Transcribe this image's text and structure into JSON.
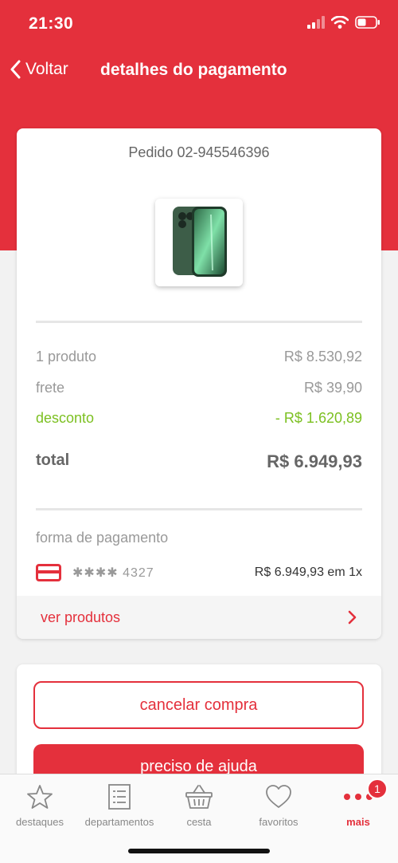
{
  "status_bar": {
    "time": "21:30"
  },
  "nav": {
    "back_label": "Voltar",
    "title": "detalhes do pagamento"
  },
  "order": {
    "number": "Pedido 02-945546396",
    "product_image": "phone-product-image",
    "summary": {
      "products_label": "1 produto",
      "products_value": "R$ 8.530,92",
      "shipping_label": "frete",
      "shipping_value": "R$ 39,90",
      "discount_label": "desconto",
      "discount_value": "- R$ 1.620,89",
      "total_label": "total",
      "total_value": "R$ 6.949,93"
    },
    "payment": {
      "label": "forma de pagamento",
      "card_masked": "✱✱✱✱ 4327",
      "amount": "R$ 6.949,93 em 1x"
    },
    "see_products_label": "ver produtos"
  },
  "actions": {
    "cancel_label": "cancelar compra",
    "help_label": "preciso de ajuda"
  },
  "tabbar": {
    "items": [
      {
        "label": "destaques",
        "icon": "star-icon"
      },
      {
        "label": "departamentos",
        "icon": "list-icon"
      },
      {
        "label": "cesta",
        "icon": "basket-icon"
      },
      {
        "label": "favoritos",
        "icon": "heart-icon"
      },
      {
        "label": "mais",
        "icon": "more-icon"
      }
    ],
    "badge_count": "1"
  },
  "colors": {
    "brand": "#e4303c",
    "discount": "#7cc021"
  }
}
